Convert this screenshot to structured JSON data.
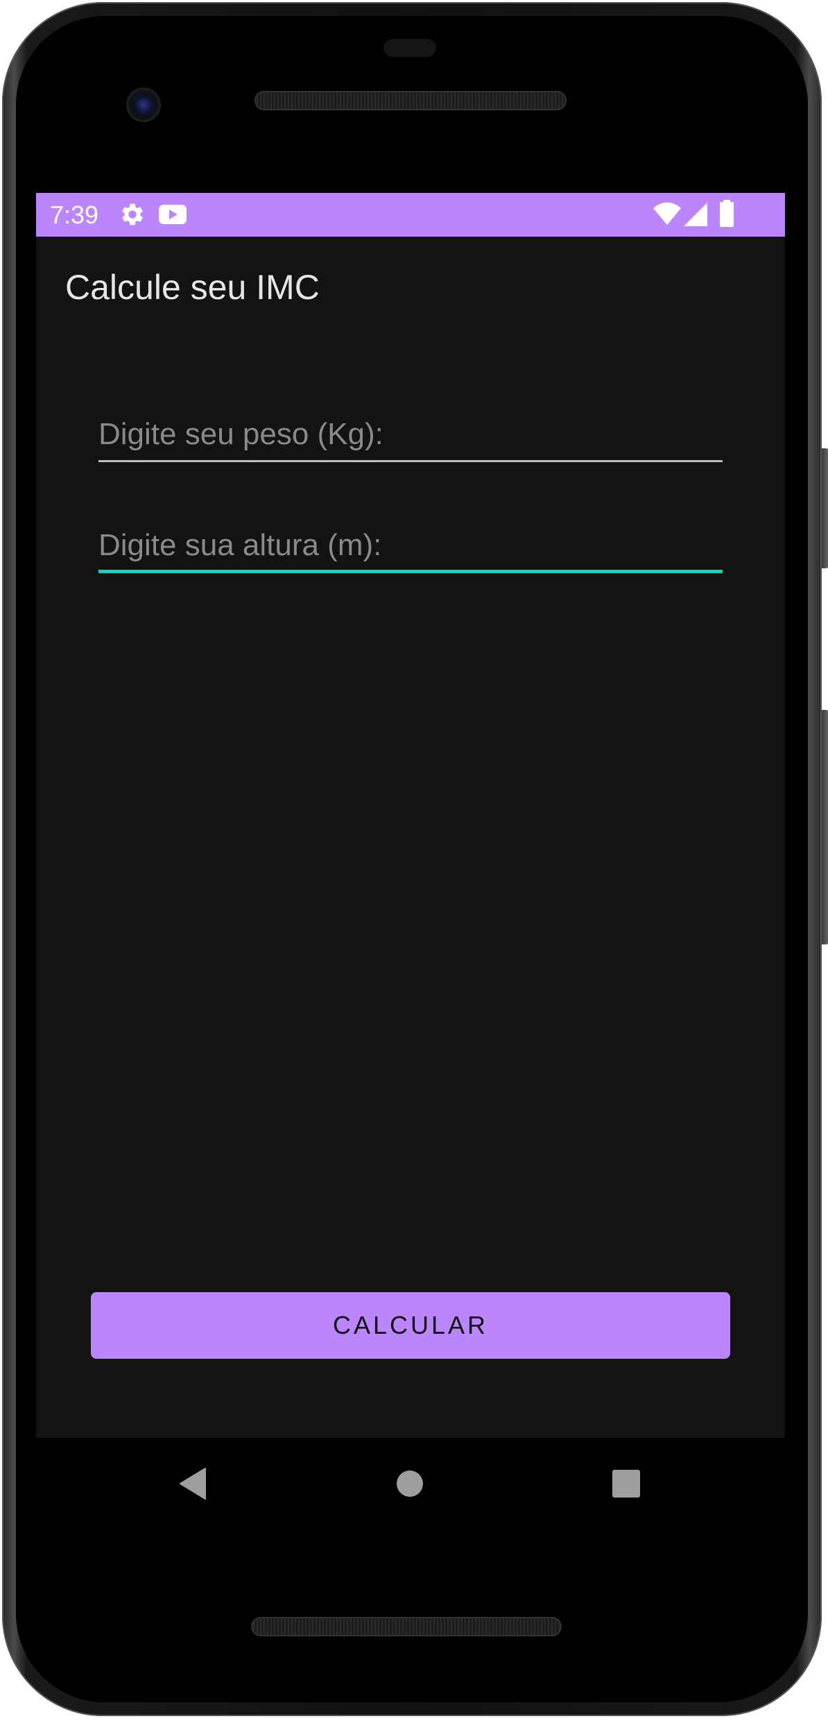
{
  "status_bar": {
    "time": "7:39",
    "background_color": "#bb86fc",
    "left_icons": [
      "settings-gear-icon",
      "youtube-play-icon"
    ],
    "right_icons": [
      "wifi-icon",
      "cell-signal-icon",
      "battery-icon"
    ]
  },
  "app": {
    "title": "Calcule seu IMC",
    "weight_field": {
      "placeholder": "Digite seu peso (Kg):",
      "value": ""
    },
    "height_field": {
      "placeholder": "Digite sua altura (m):",
      "value": "",
      "focused": true
    },
    "calculate_button_label": "CALCULAR",
    "accent_color": "#bb86fc",
    "focus_color": "#03dac5",
    "background_color": "#131313"
  },
  "navigation_bar": {
    "buttons": [
      "back-triangle-icon",
      "home-circle-icon",
      "recents-square-icon"
    ]
  }
}
